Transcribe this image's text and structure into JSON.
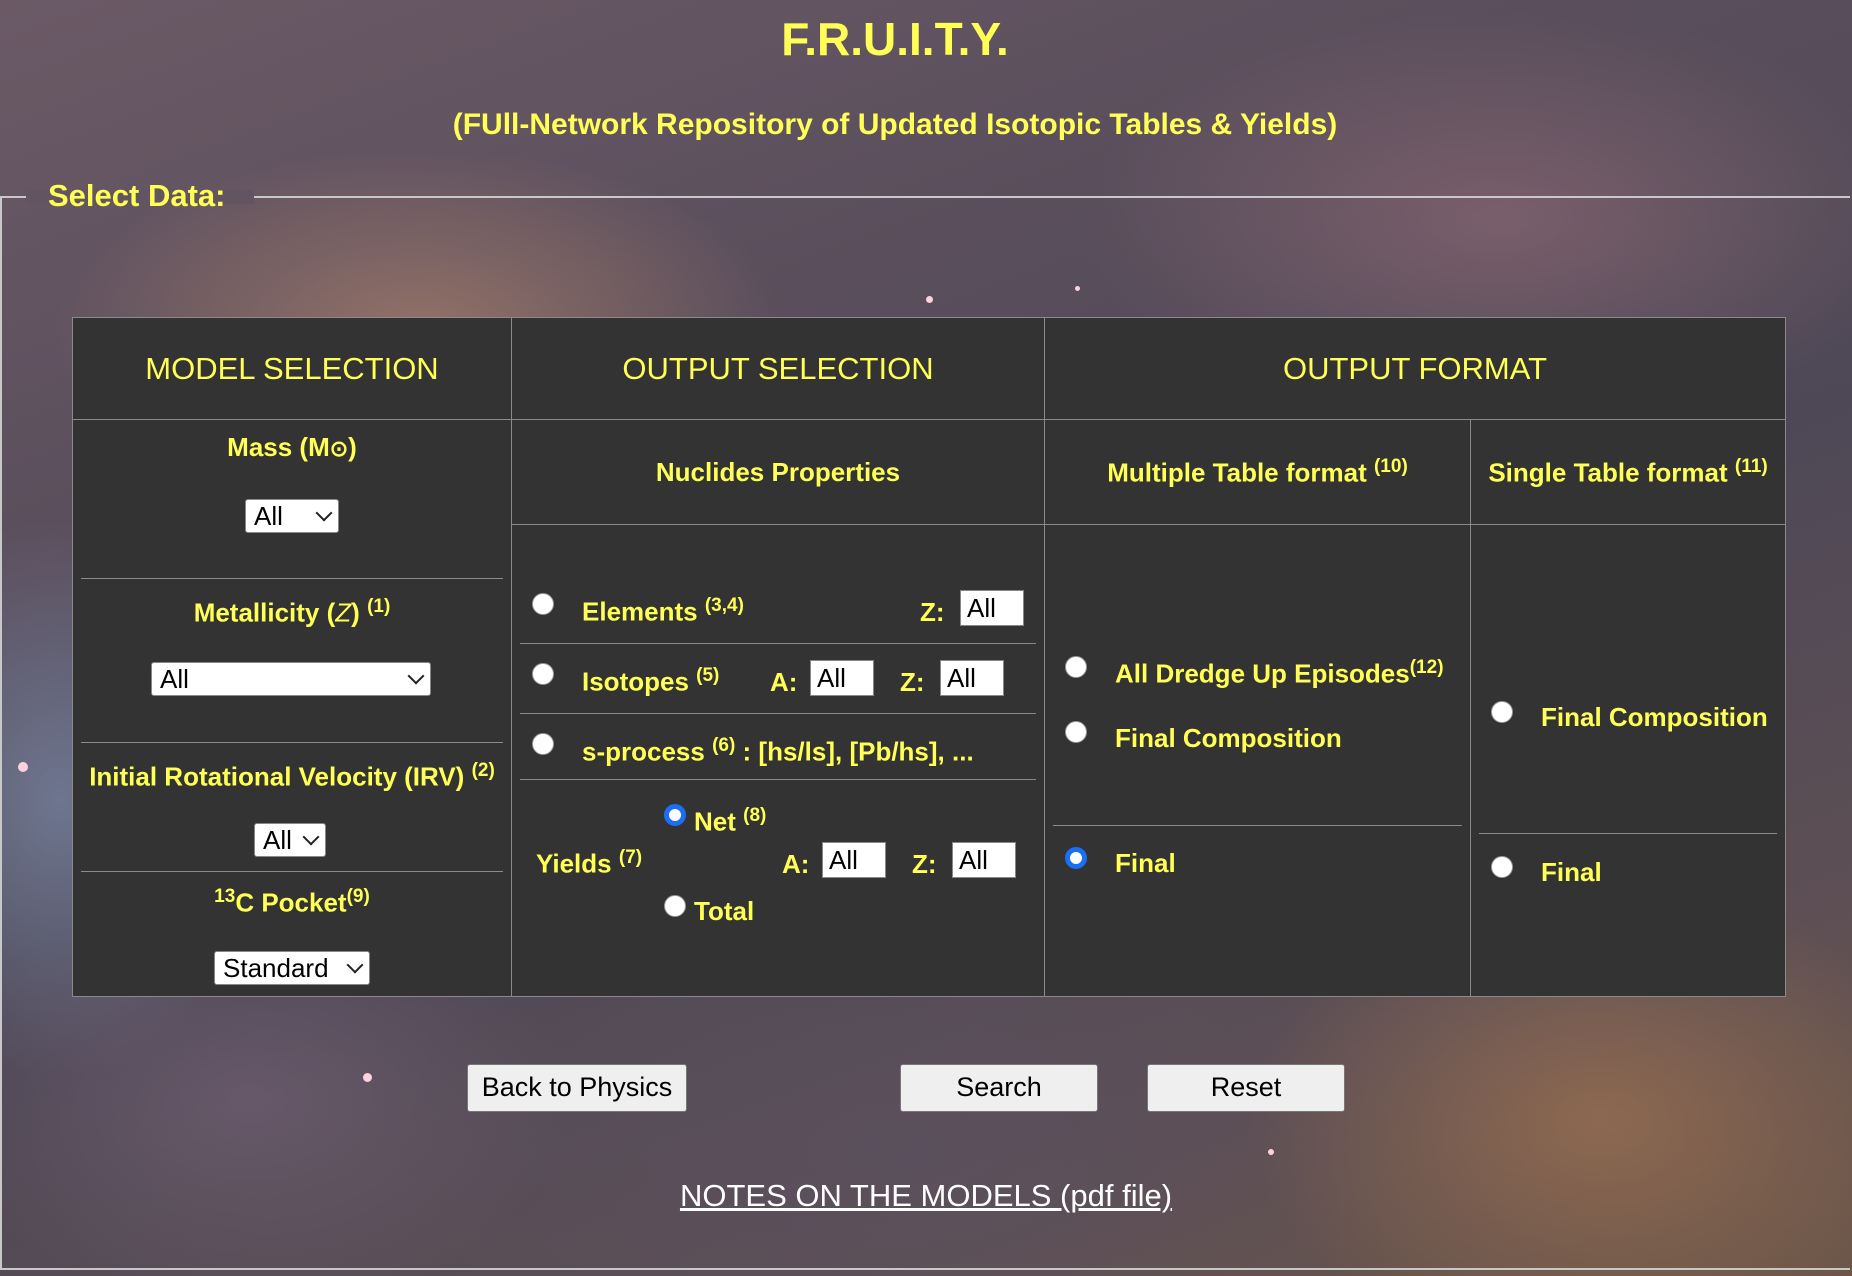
{
  "page": {
    "title": "F.R.U.I.T.Y.",
    "subtitle": "(FUll-Network Repository of Updated Isotopic Tables & Yields)",
    "legend": "Select Data:"
  },
  "headers": {
    "model": "MODEL SELECTION",
    "output_selection": "OUTPUT SELECTION",
    "output_format": "OUTPUT FORMAT"
  },
  "model": {
    "mass_label": "Mass (M",
    "mass_sun": "⊙",
    "mass_close": ")",
    "mass_value": "All",
    "metallicity_label": "Metallicity (",
    "metallicity_z": "Z",
    "metallicity_close": ")",
    "metallicity_note": "(1)",
    "metallicity_value": "All",
    "irv_label": "Initial Rotational Velocity (IRV)",
    "irv_note": "(2)",
    "irv_value": "All",
    "pocket_sup": "13",
    "pocket_label": "C Pocket",
    "pocket_note": "(9)",
    "pocket_value": "Standard"
  },
  "output_selection": {
    "nuclides_header": "Nuclides Properties",
    "elements_label": "Elements",
    "elements_note": "(3,4)",
    "elements_z_label": "Z:",
    "elements_z_value": "All",
    "isotopes_label": "Isotopes",
    "isotopes_note": "(5)",
    "isotopes_a_label": "A:",
    "isotopes_a_value": "All",
    "isotopes_z_label": "Z:",
    "isotopes_z_value": "All",
    "sprocess_label": "s-process",
    "sprocess_note": "(6)",
    "sprocess_rest": ": [hs/ls], [Pb/hs], ...",
    "yields_label": "Yields",
    "yields_note": "(7)",
    "net_label": "Net",
    "net_note": "(8)",
    "total_label": "Total",
    "yields_a_label": "A:",
    "yields_a_value": "All",
    "yields_z_label": "Z:",
    "yields_z_value": "All"
  },
  "output_format": {
    "multiple_header": "Multiple Table format",
    "multiple_note": "(10)",
    "single_header": "Single Table format",
    "single_note": "(11)",
    "all_dredge_label": "All Dredge Up Episodes",
    "all_dredge_note": "(12)",
    "final_composition_label": "Final Composition",
    "final_label": "Final",
    "single_final_composition_label": "Final Composition",
    "single_final_label": "Final"
  },
  "buttons": {
    "back": "Back to Physics",
    "search": "Search",
    "reset": "Reset"
  },
  "notes_link": "NOTES ON THE MODELS (pdf file)",
  "colors": {
    "accent_text": "#ffff55",
    "table_bg": "#333333",
    "radio_selected": "#1a6ff5"
  }
}
